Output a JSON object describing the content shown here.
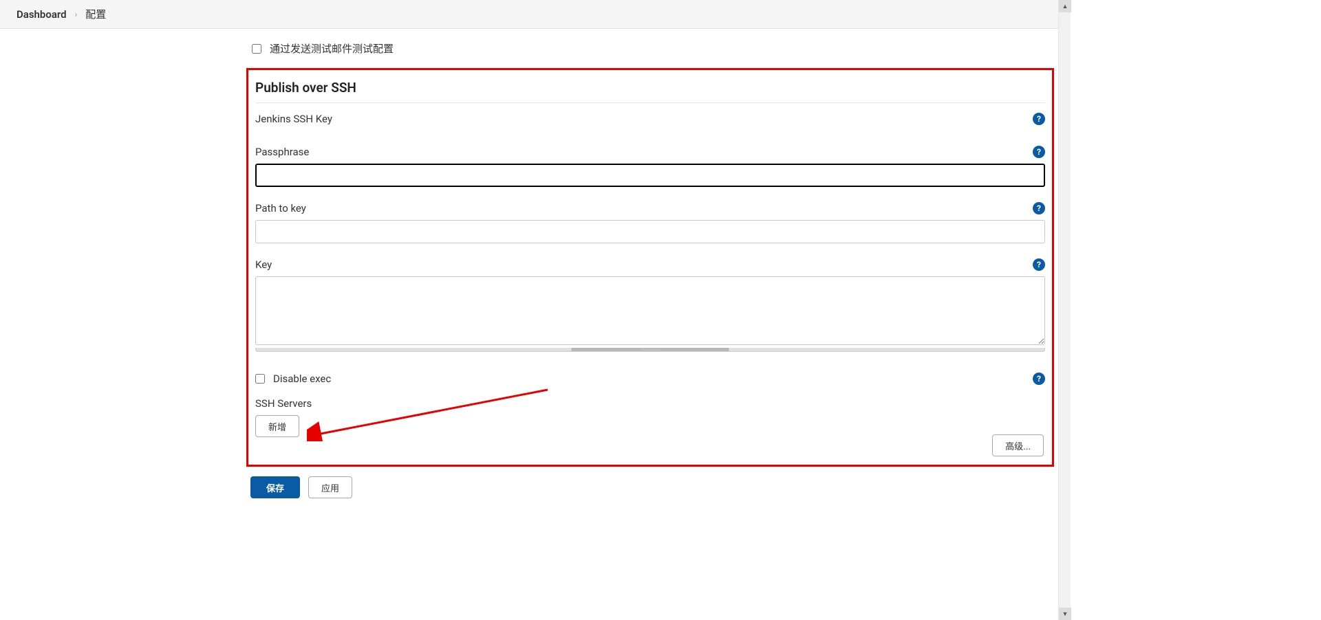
{
  "breadcrumb": {
    "root": "Dashboard",
    "current": "配置"
  },
  "topCheckbox": {
    "label": "通过发送测试邮件测试配置",
    "checked": false
  },
  "section": {
    "title": "Publish over SSH",
    "jenkins_key_label": "Jenkins SSH Key",
    "passphrase": {
      "label": "Passphrase",
      "value": ""
    },
    "path_to_key": {
      "label": "Path to key",
      "value": ""
    },
    "key": {
      "label": "Key",
      "value": ""
    },
    "disable_exec": {
      "label": "Disable exec",
      "checked": false
    },
    "ssh_servers_label": "SSH Servers",
    "add_button": "新增",
    "advanced_button": "高级..."
  },
  "footer": {
    "save": "保存",
    "apply": "应用"
  },
  "icons": {
    "help": "?"
  }
}
